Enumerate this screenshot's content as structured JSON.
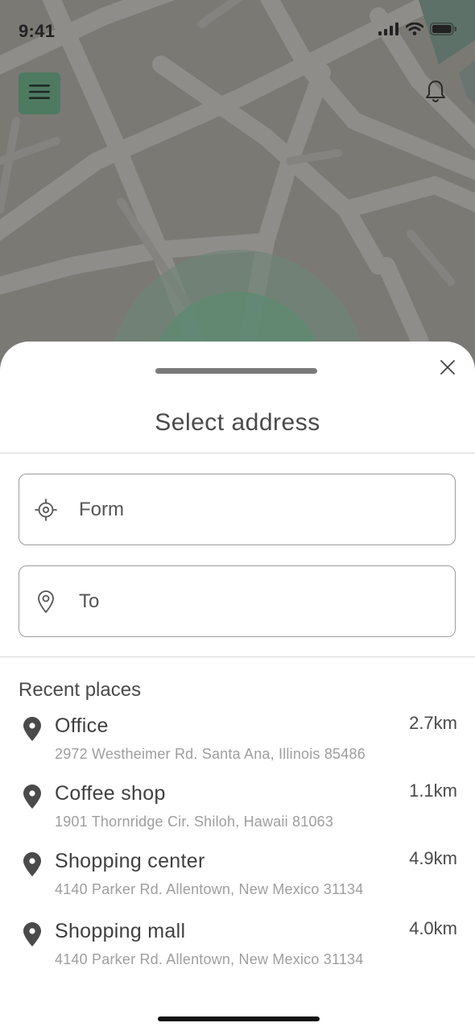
{
  "status_bar": {
    "time": "9:41"
  },
  "map": {
    "accent_color": "#4e7a62",
    "icons": [
      "menu-icon",
      "bell-icon"
    ]
  },
  "sheet": {
    "title": "Select address",
    "from_placeholder": "Form",
    "to_placeholder": "To",
    "recent_heading": "Recent places",
    "places": [
      {
        "name": "Office",
        "address": "2972 Westheimer Rd. Santa Ana, Illinois 85486",
        "distance": "2.7km"
      },
      {
        "name": "Coffee shop",
        "address": "1901 Thornridge Cir. Shiloh, Hawaii 81063",
        "distance": "1.1km"
      },
      {
        "name": "Shopping center",
        "address": "4140 Parker Rd. Allentown, New Mexico 31134",
        "distance": "4.9km"
      },
      {
        "name": "Shopping mall",
        "address": "4140 Parker Rd. Allentown, New Mexico 31134",
        "distance": "4.0km"
      }
    ]
  }
}
